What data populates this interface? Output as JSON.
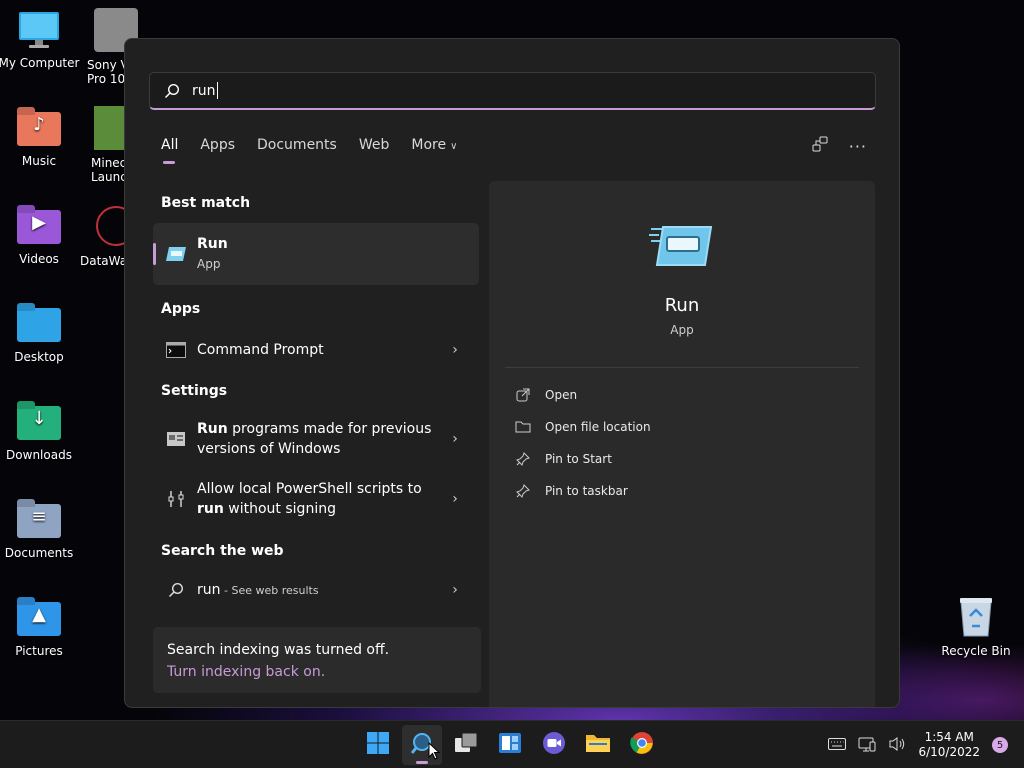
{
  "desktop": {
    "icons": [
      {
        "label": "My Computer"
      },
      {
        "label": "Music"
      },
      {
        "label": "Videos"
      },
      {
        "label": "Desktop"
      },
      {
        "label": "Downloads"
      },
      {
        "label": "Documents"
      },
      {
        "label": "Pictures"
      }
    ],
    "partial_icons": [
      {
        "line1": "Sony Ve",
        "line2": "Pro 10"
      },
      {
        "line1": "Minec",
        "line2": "Launc"
      },
      {
        "line1": "DataWag",
        "line2": ""
      }
    ],
    "recycle_bin": "Recycle Bin"
  },
  "search": {
    "query": "run",
    "tabs": [
      "All",
      "Apps",
      "Documents",
      "Web",
      "More"
    ],
    "active_tab": "All"
  },
  "results": {
    "best_match_heading": "Best match",
    "best_match": {
      "title": "Run",
      "subtitle": "App"
    },
    "apps_heading": "Apps",
    "apps": [
      {
        "title": "Command Prompt"
      }
    ],
    "settings_heading": "Settings",
    "settings": [
      {
        "bold": "Run",
        "rest": " programs made for previous versions of Windows"
      },
      {
        "pre": "Allow local PowerShell scripts to ",
        "bold": "run",
        "rest": " without signing"
      }
    ],
    "web_heading": "Search the web",
    "web": {
      "term": "run",
      "hint": " - See web results"
    }
  },
  "indexing": {
    "message": "Search indexing was turned off.",
    "link": "Turn indexing back on."
  },
  "preview": {
    "title": "Run",
    "subtitle": "App",
    "actions": [
      "Open",
      "Open file location",
      "Pin to Start",
      "Pin to taskbar"
    ]
  },
  "taskbar": {
    "time": "1:54 AM",
    "date": "6/10/2022",
    "notification_count": "5"
  },
  "colors": {
    "accent": "#c79bd6",
    "panel": "#202020",
    "preview": "#2a2a2a"
  }
}
